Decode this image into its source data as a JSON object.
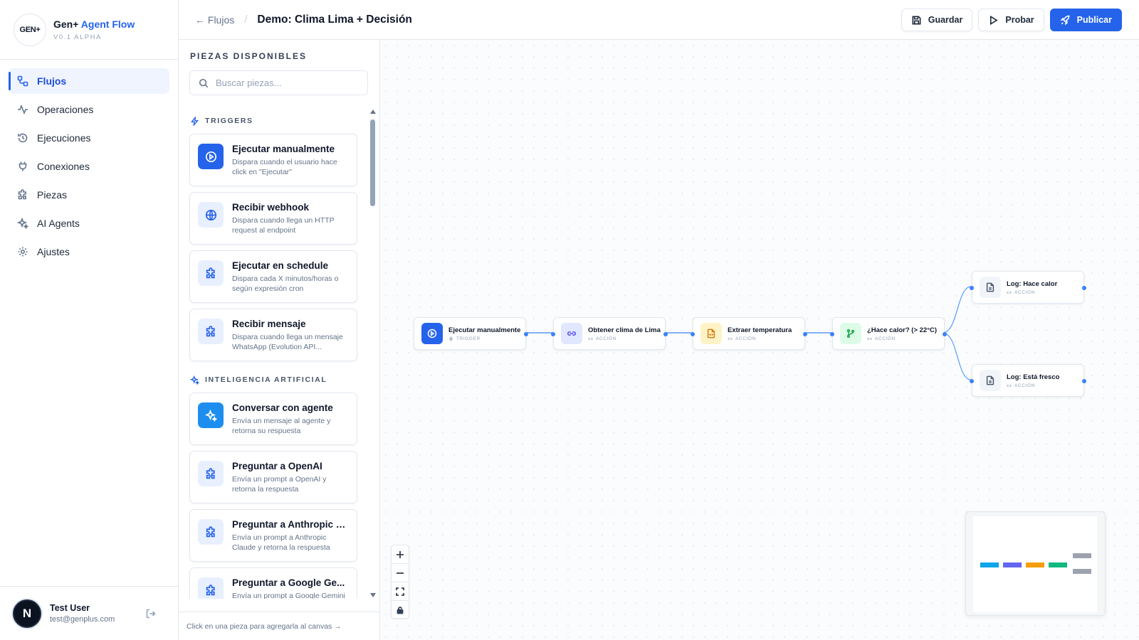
{
  "brand": {
    "logo_text": "GEN+",
    "name_prefix": "Gen+",
    "name_accent": "Agent Flow",
    "version": "V0.1 ALPHA"
  },
  "nav": {
    "items": [
      {
        "label": "Flujos",
        "icon": "flow-icon",
        "active": true
      },
      {
        "label": "Operaciones",
        "icon": "activity-icon"
      },
      {
        "label": "Ejecuciones",
        "icon": "history-icon"
      },
      {
        "label": "Conexiones",
        "icon": "plug-icon"
      },
      {
        "label": "Piezas",
        "icon": "puzzle-icon"
      },
      {
        "label": "AI Agents",
        "icon": "sparkles-icon"
      },
      {
        "label": "Ajustes",
        "icon": "gear-icon"
      }
    ]
  },
  "user": {
    "initial": "N",
    "name": "Test User",
    "email": "test@genplus.com"
  },
  "header": {
    "back_label": "← Flujos",
    "separator": "/",
    "title": "Demo: Clima Lima + Decisión",
    "save_label": "Guardar",
    "test_label": "Probar",
    "publish_label": "Publicar"
  },
  "panel": {
    "title": "PIEZAS DISPONIBLES",
    "search_placeholder": "Buscar piezas...",
    "footer": "Click en una pieza para agregarla al canvas →",
    "sections": [
      {
        "label": "TRIGGERS",
        "icon": "bolt-icon",
        "items": [
          {
            "title": "Ejecutar manualmente",
            "desc": "Dispara cuando el usuario hace click en \"Ejecutar\"",
            "icon": "play-icon"
          },
          {
            "title": "Recibir webhook",
            "desc": "Dispara cuando llega un HTTP request al endpoint",
            "icon": "globe-icon"
          },
          {
            "title": "Ejecutar en schedule",
            "desc": "Dispara cada X minutos/horas o según expresión cron",
            "icon": "puzzle-icon"
          },
          {
            "title": "Recibir mensaje",
            "desc": "Dispara cuando llega un mensaje WhatsApp (Evolution API...",
            "icon": "puzzle-icon"
          }
        ]
      },
      {
        "label": "INTELIGENCIA ARTIFICIAL",
        "icon": "sparkles-icon",
        "items": [
          {
            "title": "Conversar con agente",
            "desc": "Envía un mensaje al agente y retorna su respuesta",
            "icon": "sparkles-icon"
          },
          {
            "title": "Preguntar a OpenAI",
            "desc": "Envía un prompt a OpenAI y retorna la respuesta",
            "icon": "puzzle-icon"
          },
          {
            "title": "Preguntar a Anthropic C...",
            "desc": "Envía un prompt a Anthropic Claude y retorna la respuesta",
            "icon": "puzzle-icon"
          },
          {
            "title": "Preguntar a Google Ge...",
            "desc": "Envía un prompt a Google Gemini",
            "icon": "puzzle-icon"
          }
        ]
      }
    ]
  },
  "canvas": {
    "nodes": [
      {
        "label": "Ejecutar manualmente",
        "type": "TRIGGER",
        "icon": "play-icon",
        "color": "#2563eb"
      },
      {
        "label": "Obtener clima de Lima",
        "type": "ACCIÓN",
        "icon": "link-icon",
        "color": "#4f46e5"
      },
      {
        "label": "Extraer temperatura",
        "type": "ACCIÓN",
        "icon": "file-code-icon",
        "color": "#d97706"
      },
      {
        "label": "¿Hace calor? (> 22°C)",
        "type": "ACCIÓN",
        "icon": "branch-icon",
        "color": "#16a34a"
      },
      {
        "label": "Log: Hace calor",
        "type": "ACCIÓN",
        "icon": "file-icon",
        "color": "#64748b"
      },
      {
        "label": "Log: Está fresco",
        "type": "ACCIÓN",
        "icon": "file-icon",
        "color": "#64748b"
      }
    ],
    "minimap_colors": [
      "#0ea5e9",
      "#6366f1",
      "#f59e0b",
      "#10b981",
      "#9ca3af"
    ]
  }
}
